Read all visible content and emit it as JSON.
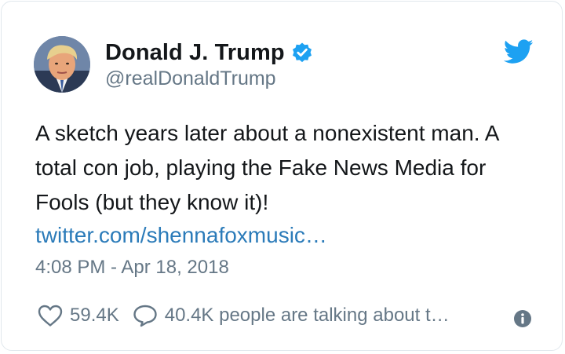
{
  "author": {
    "display_name": "Donald J. Trump",
    "handle": "@realDonaldTrump",
    "verified": true,
    "avatar_icon": "profile-photo"
  },
  "tweet": {
    "text": "A sketch years later about a nonexistent man. A total con job, playing the Fake News Media for Fools (but they know it)!",
    "link_text": "twitter.com/shennafoxmusic…",
    "timestamp": "4:08 PM - Apr 18, 2018"
  },
  "actions": {
    "like_icon": "heart-icon",
    "like_count": "59.4K",
    "reply_icon": "speech-bubble-icon",
    "reply_text": "40.4K people are talking about t…",
    "info_icon": "info-icon"
  },
  "colors": {
    "twitter_blue": "#1da1f2",
    "link_blue": "#2b7bb9",
    "muted_gray": "#657786",
    "text_dark": "#14171a",
    "border": "#e1e8ed"
  }
}
